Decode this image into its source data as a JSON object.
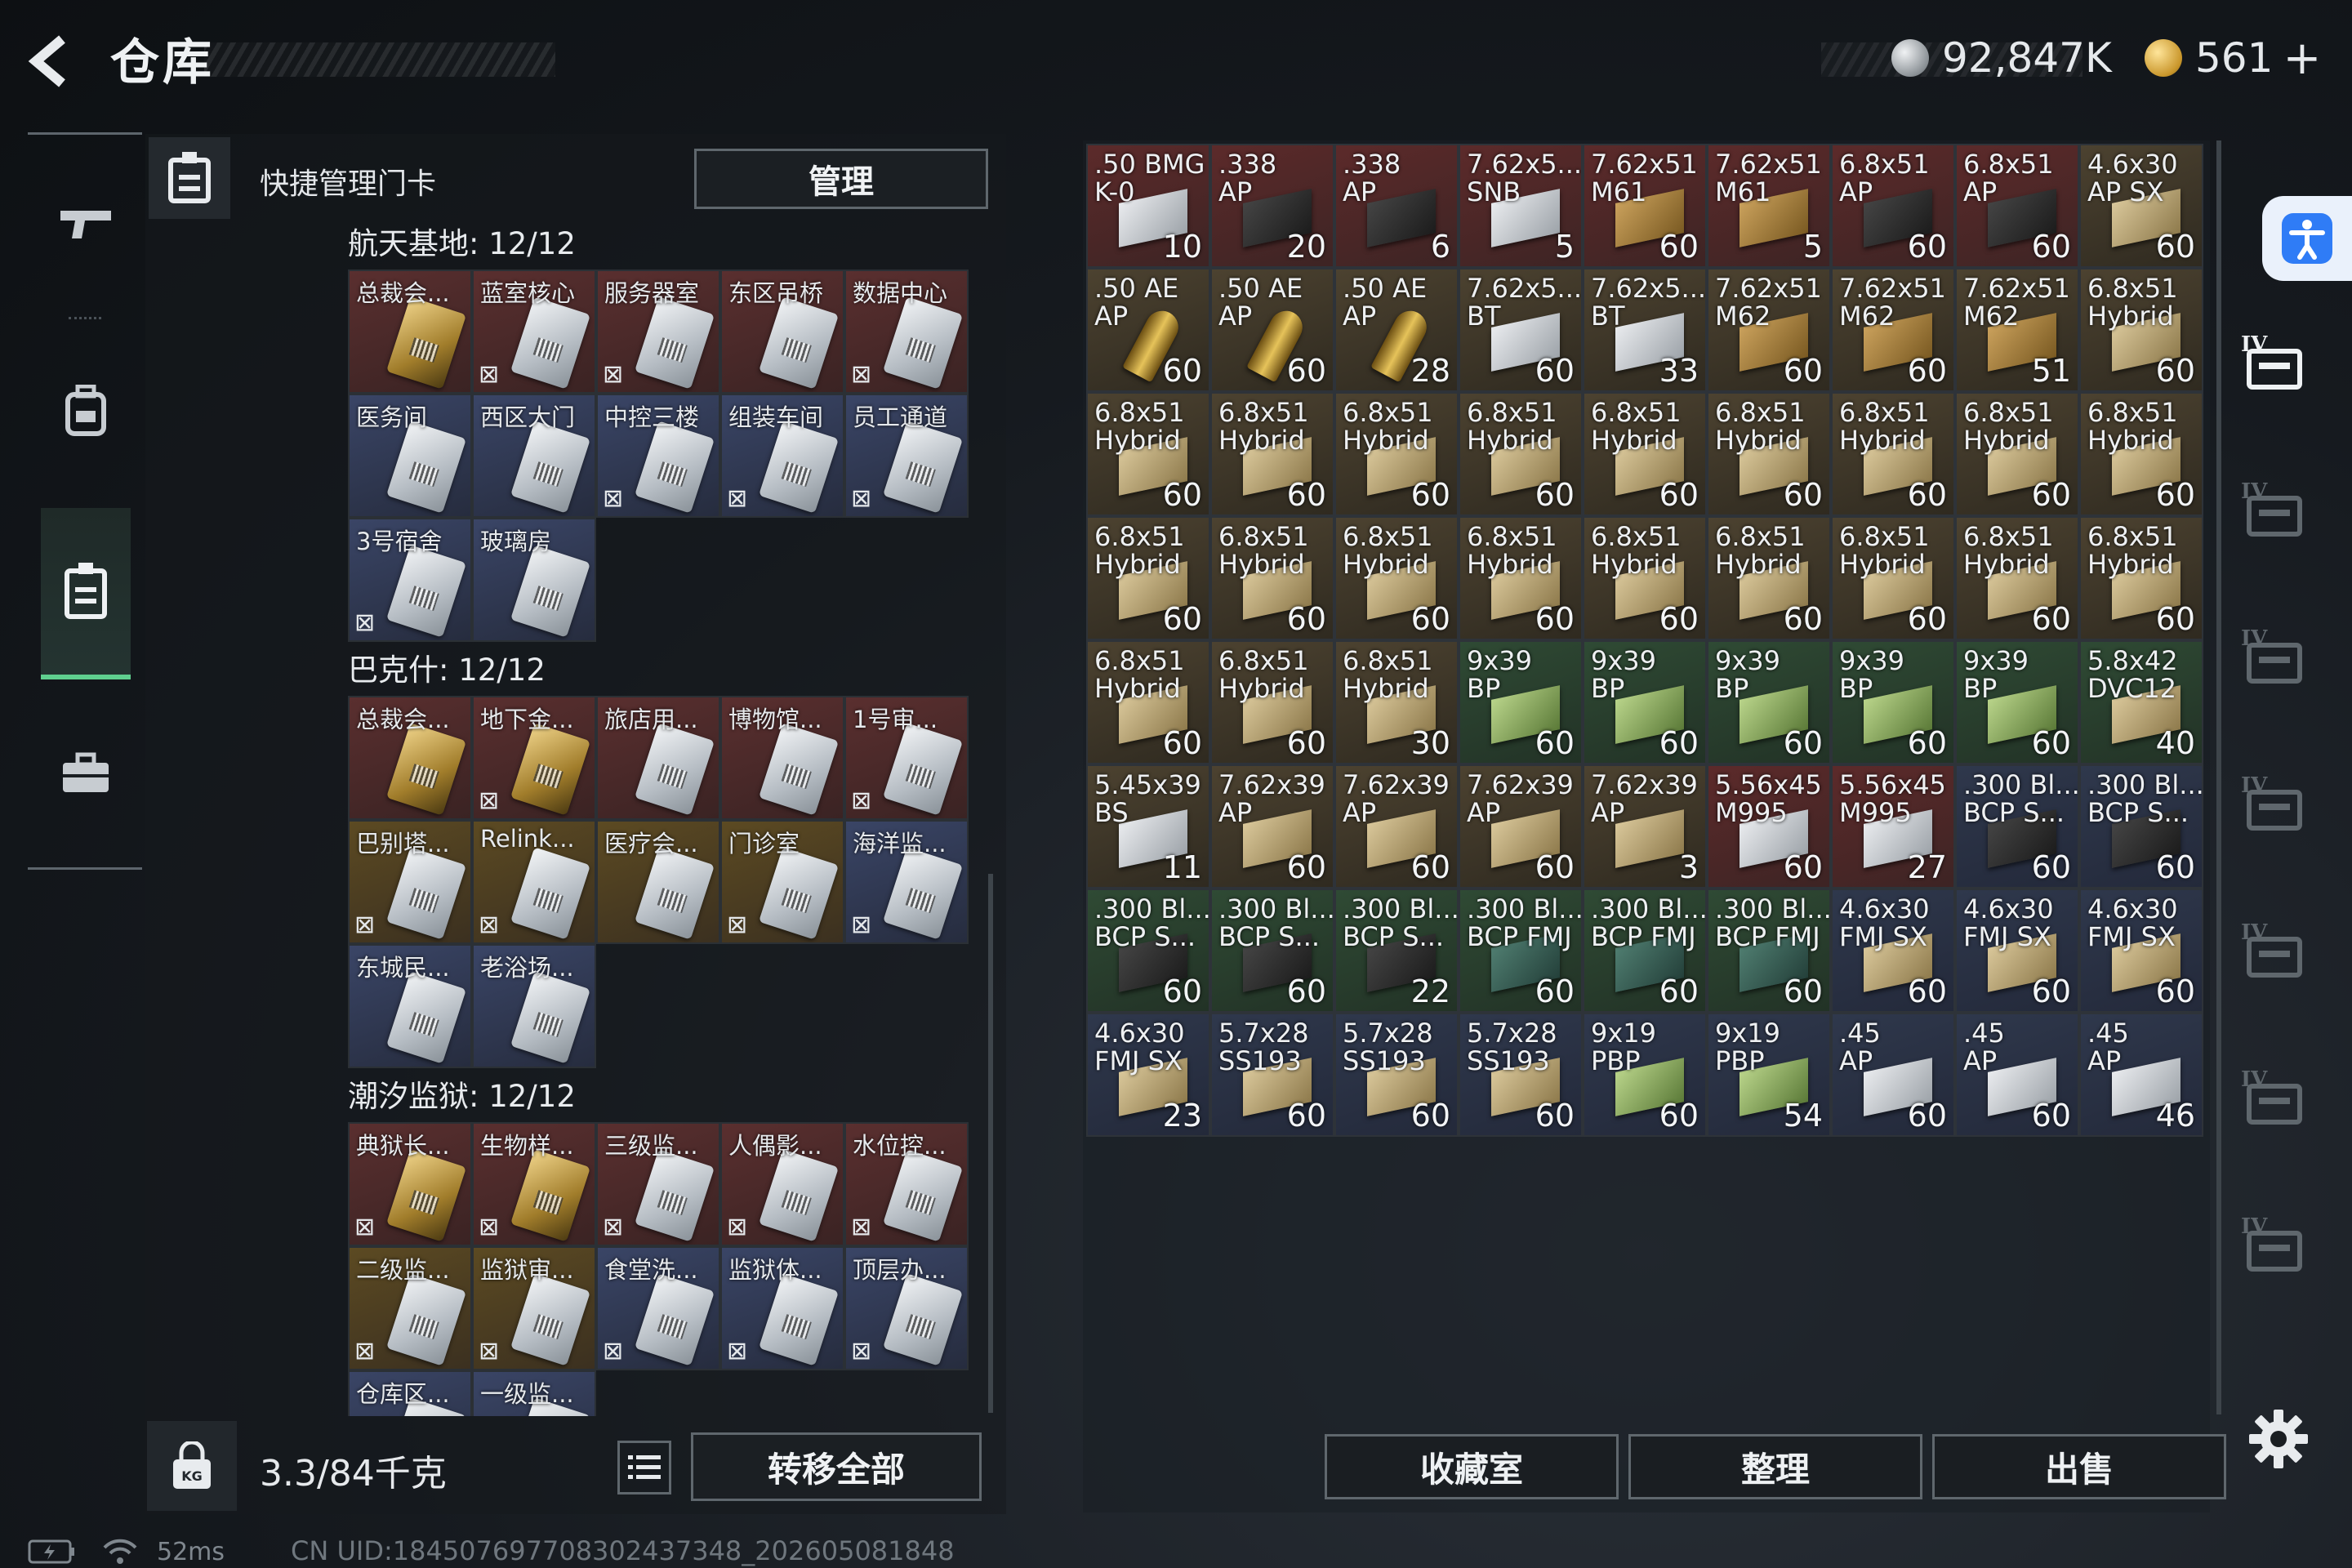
{
  "header": {
    "title": "仓库"
  },
  "currency": {
    "silver": "92,847K",
    "gold": "561",
    "add": "+"
  },
  "keycards": {
    "header_label": "快捷管理门卡",
    "manage_label": "管理",
    "sections": [
      {
        "title": "航天基地: 12/12",
        "cards": [
          {
            "name": "总裁会...",
            "color": "red",
            "img": "gold",
            "locked": false
          },
          {
            "name": "蓝室核心",
            "color": "red",
            "img": "white",
            "locked": true
          },
          {
            "name": "服务器室",
            "color": "red",
            "img": "white",
            "locked": true
          },
          {
            "name": "东区吊桥",
            "color": "red",
            "img": "white",
            "locked": false
          },
          {
            "name": "数据中心",
            "color": "red",
            "img": "white",
            "locked": true
          },
          {
            "name": "医务间",
            "color": "blue",
            "img": "white",
            "locked": false
          },
          {
            "name": "西区大门",
            "color": "blue",
            "img": "white",
            "locked": false
          },
          {
            "name": "中控三楼",
            "color": "blue",
            "img": "white",
            "locked": true
          },
          {
            "name": "组装车间",
            "color": "blue",
            "img": "white",
            "locked": true
          },
          {
            "name": "员工通道",
            "color": "blue",
            "img": "white",
            "locked": true
          },
          {
            "name": "3号宿舍",
            "color": "blue",
            "img": "white",
            "locked": true
          },
          {
            "name": "玻璃房",
            "color": "blue",
            "img": "white",
            "locked": false
          }
        ]
      },
      {
        "title": "巴克什: 12/12",
        "cards": [
          {
            "name": "总裁会...",
            "color": "red",
            "img": "gold",
            "locked": false
          },
          {
            "name": "地下金...",
            "color": "red",
            "img": "gold",
            "locked": true
          },
          {
            "name": "旅店用...",
            "color": "red",
            "img": "white",
            "locked": false
          },
          {
            "name": "博物馆...",
            "color": "red",
            "img": "white",
            "locked": false
          },
          {
            "name": "1号审...",
            "color": "red",
            "img": "white",
            "locked": true
          },
          {
            "name": "巴别塔...",
            "color": "gold",
            "img": "white",
            "locked": true
          },
          {
            "name": "Relink...",
            "color": "gold",
            "img": "white",
            "locked": true
          },
          {
            "name": "医疗会...",
            "color": "gold",
            "img": "white",
            "locked": false
          },
          {
            "name": "门诊室",
            "color": "gold",
            "img": "white",
            "locked": true
          },
          {
            "name": "海洋监...",
            "color": "blue",
            "img": "white",
            "locked": true
          },
          {
            "name": "东城民...",
            "color": "blue",
            "img": "white",
            "locked": false
          },
          {
            "name": "老浴场...",
            "color": "blue",
            "img": "white",
            "locked": false
          }
        ]
      },
      {
        "title": "潮汐监狱: 12/12",
        "cards": [
          {
            "name": "典狱长...",
            "color": "red",
            "img": "gold",
            "locked": true
          },
          {
            "name": "生物样...",
            "color": "red",
            "img": "gold",
            "locked": true
          },
          {
            "name": "三级监...",
            "color": "red",
            "img": "white",
            "locked": true
          },
          {
            "name": "人偶影...",
            "color": "red",
            "img": "white",
            "locked": true
          },
          {
            "name": "水位控...",
            "color": "red",
            "img": "white",
            "locked": true
          },
          {
            "name": "二级监...",
            "color": "gold",
            "img": "white",
            "locked": true
          },
          {
            "name": "监狱审...",
            "color": "gold",
            "img": "white",
            "locked": true
          },
          {
            "name": "食堂洗...",
            "color": "blue",
            "img": "white",
            "locked": true
          },
          {
            "name": "监狱体...",
            "color": "blue",
            "img": "white",
            "locked": true
          },
          {
            "name": "顶层办...",
            "color": "blue",
            "img": "white",
            "locked": true
          },
          {
            "name": "仓库区...",
            "color": "blue",
            "img": "white",
            "locked": false
          },
          {
            "name": "一级监...",
            "color": "blue",
            "img": "white",
            "locked": false
          }
        ]
      }
    ]
  },
  "inventory": {
    "weight": "3.3/84千克",
    "transfer_label": "转移全部"
  },
  "storage": {
    "items": [
      {
        "n1": ".50 BMG",
        "n2": "K-0",
        "q": "10",
        "c": "red",
        "b": "box-white"
      },
      {
        "n1": ".338",
        "n2": "AP",
        "q": "20",
        "c": "red",
        "b": "box-dark"
      },
      {
        "n1": ".338",
        "n2": "AP",
        "q": "6",
        "c": "red",
        "b": "box-dark"
      },
      {
        "n1": "7.62x5...",
        "n2": "SNB",
        "q": "5",
        "c": "red",
        "b": "box-white"
      },
      {
        "n1": "7.62x51",
        "n2": "M61",
        "q": "60",
        "c": "red",
        "b": "box-brown"
      },
      {
        "n1": "7.62x51",
        "n2": "M61",
        "q": "5",
        "c": "red",
        "b": "box-brown"
      },
      {
        "n1": "6.8x51",
        "n2": "AP",
        "q": "60",
        "c": "red",
        "b": "box-dark"
      },
      {
        "n1": "6.8x51",
        "n2": "AP",
        "q": "60",
        "c": "red",
        "b": "box-dark"
      },
      {
        "n1": "4.6x30",
        "n2": "AP SX",
        "q": "60",
        "c": "gold",
        "b": "box-tan"
      },
      {
        "n1": ".50 AE",
        "n2": "AP",
        "q": "60",
        "c": "gold",
        "b": "box-bullet"
      },
      {
        "n1": ".50 AE",
        "n2": "AP",
        "q": "60",
        "c": "gold",
        "b": "box-bullet"
      },
      {
        "n1": ".50 AE",
        "n2": "AP",
        "q": "28",
        "c": "gold",
        "b": "box-bullet"
      },
      {
        "n1": "7.62x5...",
        "n2": "BT",
        "q": "60",
        "c": "gold",
        "b": "box-white"
      },
      {
        "n1": "7.62x5...",
        "n2": "BT",
        "q": "33",
        "c": "gold",
        "b": "box-white"
      },
      {
        "n1": "7.62x51",
        "n2": "M62",
        "q": "60",
        "c": "gold",
        "b": "box-brown"
      },
      {
        "n1": "7.62x51",
        "n2": "M62",
        "q": "60",
        "c": "gold",
        "b": "box-brown"
      },
      {
        "n1": "7.62x51",
        "n2": "M62",
        "q": "51",
        "c": "gold",
        "b": "box-brown"
      },
      {
        "n1": "6.8x51",
        "n2": "Hybrid",
        "q": "60",
        "c": "gold",
        "b": "box-tan"
      },
      {
        "n1": "6.8x51",
        "n2": "Hybrid",
        "q": "60",
        "c": "gold",
        "b": "box-tan"
      },
      {
        "n1": "6.8x51",
        "n2": "Hybrid",
        "q": "60",
        "c": "gold",
        "b": "box-tan"
      },
      {
        "n1": "6.8x51",
        "n2": "Hybrid",
        "q": "60",
        "c": "gold",
        "b": "box-tan"
      },
      {
        "n1": "6.8x51",
        "n2": "Hybrid",
        "q": "60",
        "c": "gold",
        "b": "box-tan"
      },
      {
        "n1": "6.8x51",
        "n2": "Hybrid",
        "q": "60",
        "c": "gold",
        "b": "box-tan"
      },
      {
        "n1": "6.8x51",
        "n2": "Hybrid",
        "q": "60",
        "c": "gold",
        "b": "box-tan"
      },
      {
        "n1": "6.8x51",
        "n2": "Hybrid",
        "q": "60",
        "c": "gold",
        "b": "box-tan"
      },
      {
        "n1": "6.8x51",
        "n2": "Hybrid",
        "q": "60",
        "c": "gold",
        "b": "box-tan"
      },
      {
        "n1": "6.8x51",
        "n2": "Hybrid",
        "q": "60",
        "c": "gold",
        "b": "box-tan"
      },
      {
        "n1": "6.8x51",
        "n2": "Hybrid",
        "q": "60",
        "c": "gold",
        "b": "box-tan"
      },
      {
        "n1": "6.8x51",
        "n2": "Hybrid",
        "q": "60",
        "c": "gold",
        "b": "box-tan"
      },
      {
        "n1": "6.8x51",
        "n2": "Hybrid",
        "q": "60",
        "c": "gold",
        "b": "box-tan"
      },
      {
        "n1": "6.8x51",
        "n2": "Hybrid",
        "q": "60",
        "c": "gold",
        "b": "box-tan"
      },
      {
        "n1": "6.8x51",
        "n2": "Hybrid",
        "q": "60",
        "c": "gold",
        "b": "box-tan"
      },
      {
        "n1": "6.8x51",
        "n2": "Hybrid",
        "q": "60",
        "c": "gold",
        "b": "box-tan"
      },
      {
        "n1": "6.8x51",
        "n2": "Hybrid",
        "q": "60",
        "c": "gold",
        "b": "box-tan"
      },
      {
        "n1": "6.8x51",
        "n2": "Hybrid",
        "q": "60",
        "c": "gold",
        "b": "box-tan"
      },
      {
        "n1": "6.8x51",
        "n2": "Hybrid",
        "q": "60",
        "c": "gold",
        "b": "box-tan"
      },
      {
        "n1": "6.8x51",
        "n2": "Hybrid",
        "q": "60",
        "c": "gold",
        "b": "box-tan"
      },
      {
        "n1": "6.8x51",
        "n2": "Hybrid",
        "q": "60",
        "c": "gold",
        "b": "box-tan"
      },
      {
        "n1": "6.8x51",
        "n2": "Hybrid",
        "q": "30",
        "c": "gold",
        "b": "box-tan"
      },
      {
        "n1": "9x39",
        "n2": "BP",
        "q": "60",
        "c": "green",
        "b": "box-green"
      },
      {
        "n1": "9x39",
        "n2": "BP",
        "q": "60",
        "c": "green",
        "b": "box-green"
      },
      {
        "n1": "9x39",
        "n2": "BP",
        "q": "60",
        "c": "green",
        "b": "box-green"
      },
      {
        "n1": "9x39",
        "n2": "BP",
        "q": "60",
        "c": "green",
        "b": "box-green"
      },
      {
        "n1": "9x39",
        "n2": "BP",
        "q": "60",
        "c": "green",
        "b": "box-green"
      },
      {
        "n1": "5.8x42",
        "n2": "DVC12",
        "q": "40",
        "c": "green",
        "b": "box-tan"
      },
      {
        "n1": "5.45x39",
        "n2": "BS",
        "q": "11",
        "c": "gold",
        "b": "box-white"
      },
      {
        "n1": "7.62x39",
        "n2": "AP",
        "q": "60",
        "c": "gold",
        "b": "box-tan"
      },
      {
        "n1": "7.62x39",
        "n2": "AP",
        "q": "60",
        "c": "gold",
        "b": "box-tan"
      },
      {
        "n1": "7.62x39",
        "n2": "AP",
        "q": "60",
        "c": "gold",
        "b": "box-tan"
      },
      {
        "n1": "7.62x39",
        "n2": "AP",
        "q": "3",
        "c": "gold",
        "b": "box-tan"
      },
      {
        "n1": "5.56x45",
        "n2": "M995",
        "q": "60",
        "c": "red",
        "b": "box-white"
      },
      {
        "n1": "5.56x45",
        "n2": "M995",
        "q": "27",
        "c": "red",
        "b": "box-white"
      },
      {
        "n1": ".300 Bl...",
        "n2": "BCP S...",
        "q": "60",
        "c": "blue",
        "b": "box-dark"
      },
      {
        "n1": ".300 Bl...",
        "n2": "BCP S...",
        "q": "60",
        "c": "blue",
        "b": "box-dark"
      },
      {
        "n1": ".300 Bl...",
        "n2": "BCP S...",
        "q": "60",
        "c": "green",
        "b": "box-dark"
      },
      {
        "n1": ".300 Bl...",
        "n2": "BCP S...",
        "q": "60",
        "c": "green",
        "b": "box-dark"
      },
      {
        "n1": ".300 Bl...",
        "n2": "BCP S...",
        "q": "22",
        "c": "green",
        "b": "box-dark"
      },
      {
        "n1": ".300 Bl...",
        "n2": "BCP FMJ",
        "q": "60",
        "c": "green",
        "b": "box-teal"
      },
      {
        "n1": ".300 Bl...",
        "n2": "BCP FMJ",
        "q": "60",
        "c": "green",
        "b": "box-teal"
      },
      {
        "n1": ".300 Bl...",
        "n2": "BCP FMJ",
        "q": "60",
        "c": "green",
        "b": "box-teal"
      },
      {
        "n1": "4.6x30",
        "n2": "FMJ SX",
        "q": "60",
        "c": "blue",
        "b": "box-tan"
      },
      {
        "n1": "4.6x30",
        "n2": "FMJ SX",
        "q": "60",
        "c": "blue",
        "b": "box-tan"
      },
      {
        "n1": "4.6x30",
        "n2": "FMJ SX",
        "q": "60",
        "c": "blue",
        "b": "box-tan"
      },
      {
        "n1": "4.6x30",
        "n2": "FMJ SX",
        "q": "23",
        "c": "blue",
        "b": "box-tan"
      },
      {
        "n1": "5.7x28",
        "n2": "SS193",
        "q": "60",
        "c": "blue",
        "b": "box-tan"
      },
      {
        "n1": "5.7x28",
        "n2": "SS193",
        "q": "60",
        "c": "blue",
        "b": "box-tan"
      },
      {
        "n1": "5.7x28",
        "n2": "SS193",
        "q": "60",
        "c": "blue",
        "b": "box-tan"
      },
      {
        "n1": "9x19",
        "n2": "PBP",
        "q": "60",
        "c": "blue",
        "b": "box-green"
      },
      {
        "n1": "9x19",
        "n2": "PBP",
        "q": "54",
        "c": "blue",
        "b": "box-green"
      },
      {
        "n1": ".45",
        "n2": "AP",
        "q": "60",
        "c": "blue",
        "b": "box-white"
      },
      {
        "n1": ".45",
        "n2": "AP",
        "q": "60",
        "c": "blue",
        "b": "box-white"
      },
      {
        "n1": ".45",
        "n2": "AP",
        "q": "46",
        "c": "blue",
        "b": "box-white"
      }
    ],
    "buttons": {
      "collection": "收藏室",
      "organize": "整理",
      "sell": "出售"
    }
  },
  "status": {
    "ping": "52ms",
    "uid": "CN UID:184507697708302437348_202605081848"
  },
  "icons": [
    "back-arrow-icon",
    "silver-coin-icon",
    "gold-coin-icon",
    "gun-icon",
    "backpack-icon",
    "keycard-icon",
    "briefcase-icon",
    "weight-lock-icon",
    "list-icon",
    "battery-icon",
    "wifi-icon",
    "accessibility-icon",
    "settings-icon",
    "container-icon"
  ],
  "colors": {
    "accent_green": "#5fd08f",
    "rarity_red": "#5a2f2f",
    "rarity_gold": "#5c4a22",
    "rarity_blue": "#3a4566",
    "rarity_green": "#2f4a34"
  }
}
